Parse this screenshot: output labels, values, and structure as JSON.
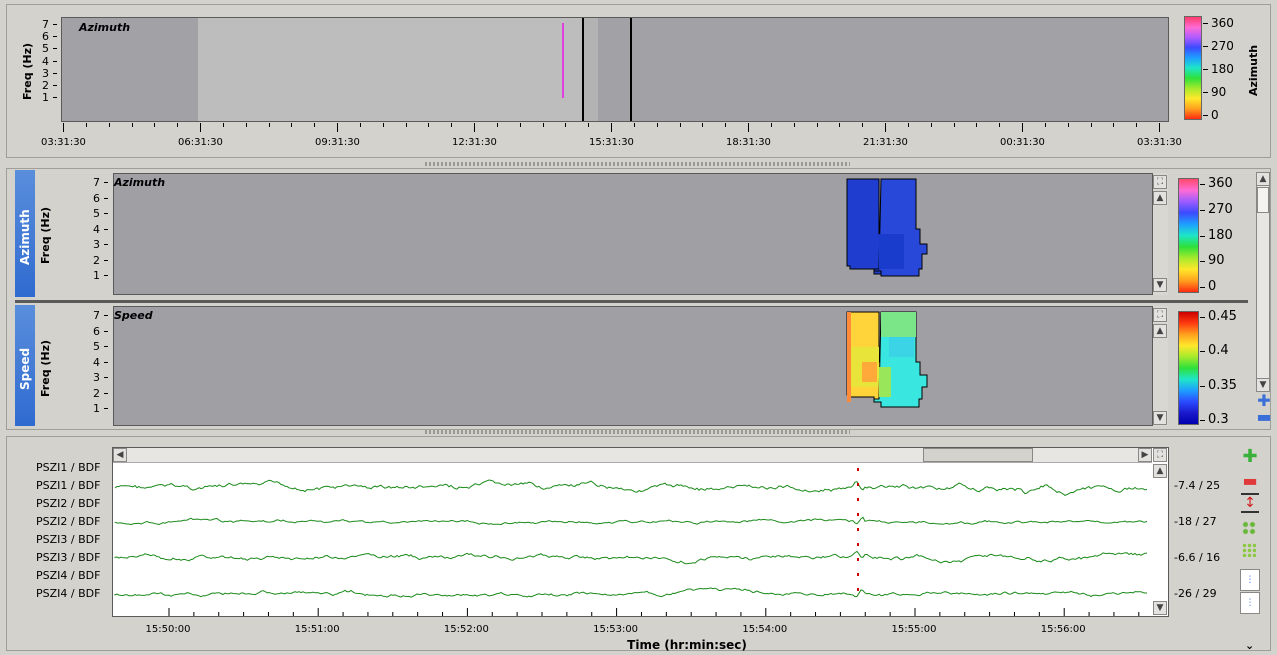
{
  "overview": {
    "title": "Azimuth",
    "ylabel": "Freq (Hz)",
    "yticks": [
      "7",
      "6",
      "5",
      "4",
      "3",
      "2",
      "1"
    ],
    "xticks": [
      "03:31:30",
      "06:31:30",
      "09:31:30",
      "12:31:30",
      "15:31:30",
      "18:31:30",
      "21:31:30",
      "00:31:30",
      "03:31:30"
    ],
    "colorbar": {
      "label": "Azimuth",
      "ticks": [
        "360",
        "270",
        "180",
        "90",
        "0"
      ]
    }
  },
  "azimuth_panel": {
    "tab": "Azimuth",
    "title": "Azimuth",
    "ylabel": "Freq (Hz)",
    "yticks": [
      "7",
      "6",
      "5",
      "4",
      "3",
      "2",
      "1"
    ],
    "colorbar": {
      "ticks": [
        "360",
        "270",
        "180",
        "90",
        "0"
      ]
    }
  },
  "speed_panel": {
    "tab": "Speed",
    "title": "Speed",
    "ylabel": "Freq (Hz)",
    "yticks": [
      "7",
      "6",
      "5",
      "4",
      "3",
      "2",
      "1"
    ],
    "colorbar": {
      "ticks": [
        "0.45",
        "0.4",
        "0.35",
        "0.3"
      ]
    }
  },
  "waveforms": {
    "channels": [
      "PSZI1 / BDF",
      "PSZI1 / BDF",
      "PSZI2 / BDF",
      "PSZI2 / BDF",
      "PSZI3 / BDF",
      "PSZI3 / BDF",
      "PSZI4 / BDF",
      "PSZI4 / BDF"
    ],
    "amplitudes": [
      "-7.4 / 25",
      "-18 / 27",
      "-6.6 / 16",
      "-26 / 29"
    ],
    "xticks": [
      "15:50:00",
      "15:51:00",
      "15:52:00",
      "15:53:00",
      "15:54:00",
      "15:55:00",
      "15:56:00"
    ],
    "xlabel": "Time (hr:min:sec)",
    "trace_color": "#1a8a1a",
    "marker_color": "#cc0000"
  }
}
